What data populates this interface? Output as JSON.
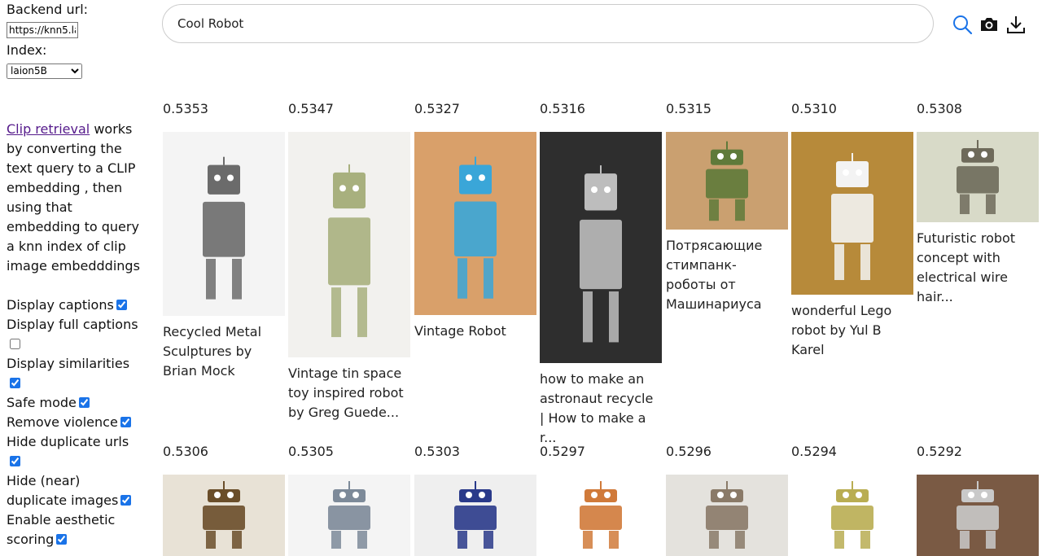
{
  "sidebar": {
    "backend_label": "Backend url:",
    "backend_value": "https://knn5.la",
    "index_label": "Index:",
    "index_value": "laion5B",
    "description_link": "Clip retrieval",
    "description_rest": " works by converting the text query to a CLIP embedding , then using that embedding to query a knn index of clip image embedddings",
    "options": {
      "display_captions": "Display captions",
      "display_full_captions": "Display full captions",
      "display_similarities": "Display similarities",
      "safe_mode": "Safe mode",
      "remove_violence": "Remove violence",
      "hide_duplicate_urls": "Hide duplicate urls",
      "hide_near_dup_1": "Hide (near)",
      "hide_near_dup_2": "duplicate images",
      "enable_aesthetic_1": "Enable aesthetic",
      "enable_aesthetic_2": "scoring"
    },
    "option_states": {
      "display_captions": true,
      "display_full_captions": false,
      "display_similarities": true,
      "safe_mode": true,
      "remove_violence": true,
      "hide_duplicate_urls": true,
      "hide_near_dup": true,
      "enable_aesthetic": true
    }
  },
  "search": {
    "query": "Cool Robot",
    "icons": [
      "search-icon",
      "camera-icon",
      "download-icon"
    ],
    "accent": "#1a73e8"
  },
  "results": {
    "row1": [
      {
        "score": "0.5353",
        "caption": "Recycled Metal Sculptures by Brian Mock",
        "bg": "#f4f4f4",
        "fg": "#6b6b6b"
      },
      {
        "score": "0.5347",
        "caption": "Vintage tin space toy inspired robot by Greg Guede...",
        "bg": "#f2f1ee",
        "fg": "#a8b07e"
      },
      {
        "score": "0.5327",
        "caption": "Vintage Robot",
        "bg": "#d9a06a",
        "fg": "#3aa6d8"
      },
      {
        "score": "0.5316",
        "caption": "how to make an astronaut recycle | How to make a r...",
        "bg": "#2e2e2e",
        "fg": "#bdbdbd"
      },
      {
        "score": "0.5315",
        "caption": "Потрясающие стимпанк-роботы от Машинариуса",
        "bg": "#caa070",
        "fg": "#5f7a3a"
      },
      {
        "score": "0.5310",
        "caption": "wonderful Lego robot by Yul B Karel",
        "bg": "#b78a3a",
        "fg": "#f3f3f3"
      },
      {
        "score": "0.5308",
        "caption": "Futuristic robot concept with electrical wire hair...",
        "bg": "#d8dac8",
        "fg": "#6e6a5a"
      }
    ],
    "row2": [
      {
        "score": "0.5306",
        "bg": "#e8e2d6",
        "fg": "#6a4e2a"
      },
      {
        "score": "0.5305",
        "bg": "#f4f4f4",
        "fg": "#7d8a99"
      },
      {
        "score": "0.5303",
        "bg": "#efefef",
        "fg": "#2a3a8a"
      },
      {
        "score": "0.5297",
        "bg": "#ffffff",
        "fg": "#d07a3a"
      },
      {
        "score": "0.5296",
        "bg": "#e4e2dd",
        "fg": "#8a7a68"
      },
      {
        "score": "0.5294",
        "bg": "#ffffff",
        "fg": "#b9ad52"
      },
      {
        "score": "0.5292",
        "bg": "#7a5a44",
        "fg": "#c9c9c9"
      }
    ]
  }
}
